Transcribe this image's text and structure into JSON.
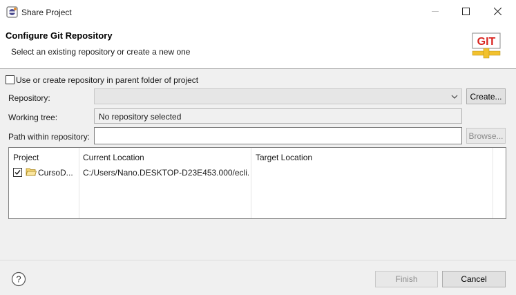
{
  "window": {
    "title": "Share Project",
    "minimize_icon": "minimize-icon",
    "maximize_icon": "maximize-icon",
    "close_icon": "close-icon"
  },
  "banner": {
    "title": "Configure Git Repository",
    "description": "Select an existing repository or create a new one",
    "logo_text": "GIT"
  },
  "form": {
    "use_parent_label": "Use or create repository in parent folder of project",
    "use_parent_checked": false,
    "repository_label": "Repository:",
    "repository_value": "",
    "create_button": "Create...",
    "working_tree_label": "Working tree:",
    "working_tree_value": "No repository selected",
    "path_label": "Path within repository:",
    "path_value": "",
    "browse_button": "Browse..."
  },
  "table": {
    "columns": [
      "Project",
      "Current Location",
      "Target Location"
    ],
    "rows": [
      {
        "checked": true,
        "project": "CursoD...",
        "current_location": "C:/Users/Nano.DESKTOP-D23E453.000/ecli...",
        "target_location": ""
      }
    ]
  },
  "footer": {
    "help_icon": "help-icon",
    "finish_button": "Finish",
    "cancel_button": "Cancel"
  },
  "colors": {
    "banner_bg": "#ffffff",
    "content_bg": "#f0f0f0",
    "git_red": "#d9241f",
    "git_yellow": "#f2c12e"
  }
}
